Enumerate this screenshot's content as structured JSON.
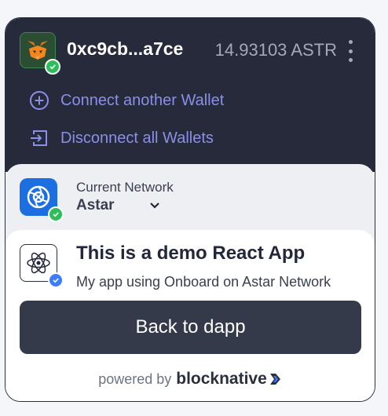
{
  "wallet": {
    "address": "0xc9cb...a7ce",
    "balance": "14.93103 ASTR",
    "icon": "metamask-fox-icon",
    "connected_badge_color": "#2ebd5b"
  },
  "actions": {
    "connect_label": "Connect another Wallet",
    "disconnect_label": "Disconnect all Wallets"
  },
  "network": {
    "label": "Current Network",
    "selected": "Astar",
    "icon": "astar-network-icon"
  },
  "app": {
    "name": "This is a demo React App",
    "description": "My app using Onboard on Astar Network",
    "icon": "react-logo-icon"
  },
  "back_button_label": "Back to dapp",
  "footer": {
    "powered_by": "powered by",
    "brand": "blocknative"
  },
  "colors": {
    "header_bg": "#262a3a",
    "action_text": "#8a8fe8",
    "button_bg": "#353a4b"
  }
}
